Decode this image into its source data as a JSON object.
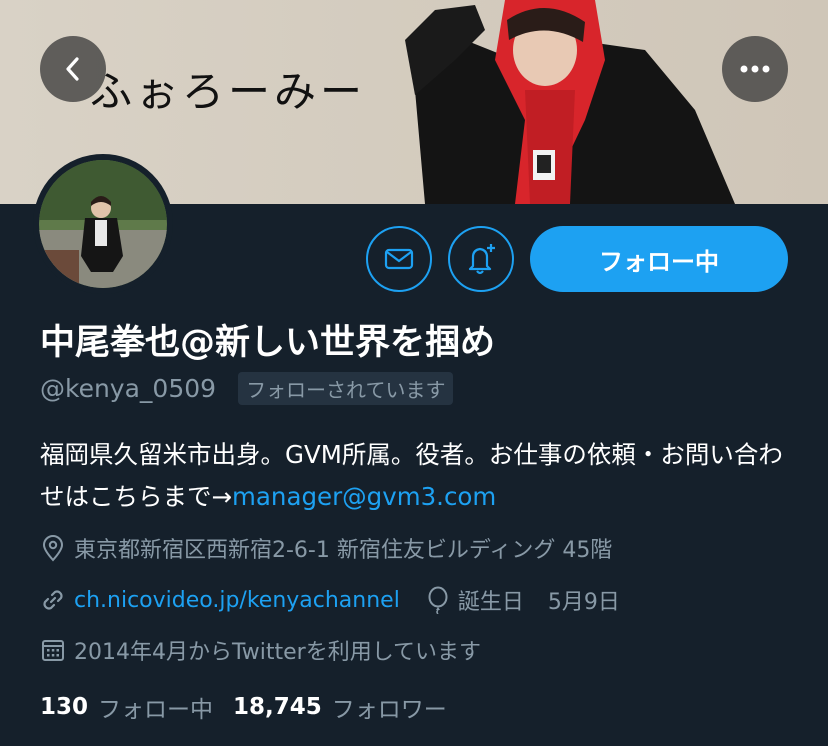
{
  "banner": {
    "text": "ふぉろーみー"
  },
  "nav": {
    "back_icon": "chevron-left-icon",
    "more_icon": "more-horizontal-icon"
  },
  "actions": {
    "message_icon": "mail-icon",
    "notify_icon": "bell-plus-icon",
    "follow_label": "フォロー中"
  },
  "profile": {
    "display_name": "中尾拳也@新しい世界を掴め",
    "handle": "@kenya_0509",
    "follows_you": "フォローされています",
    "bio_text": "福岡県久留米市出身。GVM所属。役者。お仕事の依頼・お問い合わせはこちらまで→",
    "bio_link": "manager@gvm3.com",
    "location": "東京都新宿区西新宿2-6-1 新宿住友ビルディング 45階",
    "website": "ch.nicovideo.jp/kenyachannel",
    "birthday_label": "誕生日",
    "birthday_value": "5月9日",
    "joined": "2014年4月からTwitterを利用しています"
  },
  "stats": {
    "following_count": "130",
    "following_label": "フォロー中",
    "followers_count": "18,745",
    "followers_label": "フォロワー"
  },
  "colors": {
    "background": "#15202b",
    "accent": "#1da1f2",
    "secondary_text": "#8899a6"
  }
}
